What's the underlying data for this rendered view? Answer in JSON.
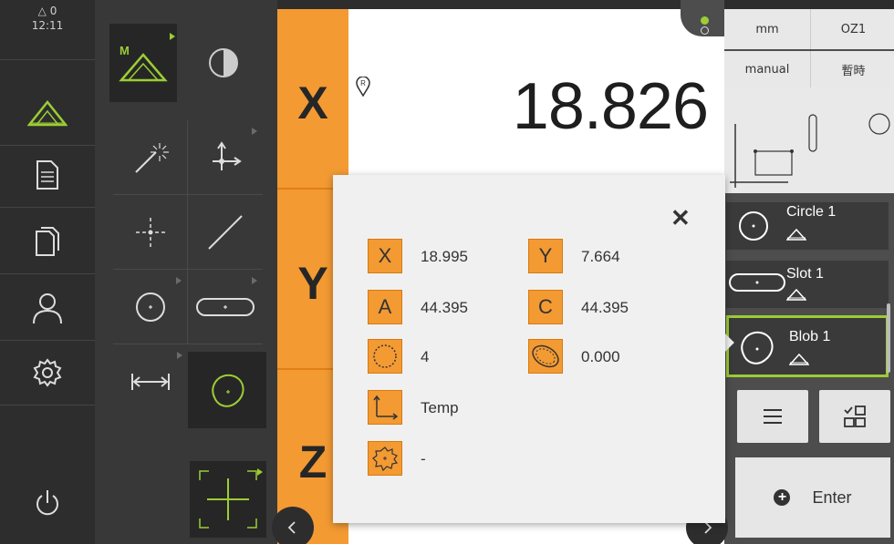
{
  "status": {
    "warnings": "0",
    "time": "12:11",
    "warning_icon": "triangle-outline-icon"
  },
  "nav": [
    {
      "name": "measure",
      "icon": "measure-triangle-icon",
      "active": true
    },
    {
      "name": "report",
      "icon": "report-document-icon"
    },
    {
      "name": "file-management",
      "icon": "files-copy-icon"
    },
    {
      "name": "user-login",
      "icon": "user-icon"
    },
    {
      "name": "settings",
      "icon": "gear-icon"
    },
    {
      "name": "power",
      "icon": "power-icon"
    }
  ],
  "axes": {
    "x_label": "X",
    "y_label": "Y",
    "z_label": "Z",
    "x_value": "18.826",
    "reference_marker": "R"
  },
  "right_panel": {
    "unit": "mm",
    "coord_system": "OZ1",
    "mode": "manual",
    "temp_label": "暫時",
    "features": [
      {
        "label": "Circle 1",
        "icon": "circle-icon"
      },
      {
        "label": "Slot 1",
        "icon": "slot-icon"
      },
      {
        "label": "Blob 1",
        "icon": "blob-icon",
        "selected": true
      }
    ],
    "enter_label": "Enter"
  },
  "popup": {
    "rows": [
      {
        "tile": "X",
        "value": "18.995",
        "tile2": "Y",
        "value2": "7.664"
      },
      {
        "tile": "A",
        "value": "44.395",
        "tile2": "C",
        "value2": "44.395"
      },
      {
        "tile_icon": "points-circle-icon",
        "value": "4",
        "tile2_icon": "form-error-icon",
        "value2": "0.000"
      },
      {
        "tile_icon": "coordinate-system-icon",
        "value": "Temp"
      },
      {
        "tile_icon": "fit-algorithm-icon",
        "value": "-"
      }
    ]
  },
  "colors": {
    "accent_orange": "#f39a33",
    "accent_green": "#9ccd34",
    "nav_bg": "#2d2d2d"
  }
}
